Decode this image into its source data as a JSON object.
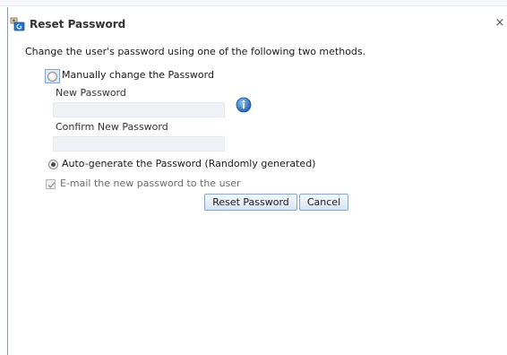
{
  "dialog": {
    "title": "Reset Password",
    "close_label": "×",
    "instructions": "Change the user's password using one of the following two methods."
  },
  "manual": {
    "label": "Manually change the Password",
    "selected": false,
    "new_password_label": "New Password",
    "new_password_value": "",
    "confirm_label": "Confirm New Password",
    "confirm_value": ""
  },
  "auto": {
    "label": "Auto-generate the Password (Randomly generated)",
    "selected": true
  },
  "email": {
    "label": "E-mail the new password to the user",
    "checked": true,
    "disabled": true
  },
  "buttons": {
    "reset": "Reset Password",
    "cancel": "Cancel"
  },
  "icons": {
    "title": "reset-password-icon",
    "info": "info-icon"
  },
  "colors": {
    "accent_blue": "#2a73c8",
    "button_border": "#8aa6c8"
  }
}
